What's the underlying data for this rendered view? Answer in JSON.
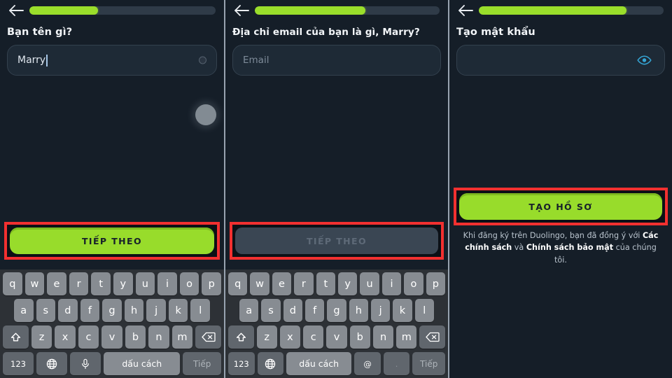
{
  "colors": {
    "accent_green": "#98dc2b",
    "highlight_red": "#f23030",
    "background": "#151e28",
    "field_bg": "#1e2a36",
    "eye_blue": "#35a6d6",
    "keyboard_bg": "#2d3136"
  },
  "panels": [
    {
      "id": "name-step",
      "back_label": "Back",
      "progress_percent": 37,
      "question": "Bạn tên gì?",
      "input": {
        "name": "name-input",
        "value": "Marry",
        "placeholder": "",
        "has_clear": true
      },
      "cta": {
        "label": "TIẾP THEO",
        "state": "enabled",
        "highlighted": true
      },
      "touch_indicator": true
    },
    {
      "id": "email-step",
      "back_label": "Back",
      "progress_percent": 60,
      "question": "Địa chỉ email của bạn là gì, Marry?",
      "input": {
        "name": "email-input",
        "value": "",
        "placeholder": "Email",
        "has_clear": false
      },
      "cta": {
        "label": "TIẾP THEO",
        "state": "disabled",
        "highlighted": true
      },
      "touch_indicator": false
    },
    {
      "id": "password-step",
      "back_label": "Back",
      "progress_percent": 80,
      "question": "Tạo mật khẩu",
      "input": {
        "name": "password-input",
        "value": "",
        "placeholder": "",
        "has_eye_toggle": true
      },
      "cta": {
        "label": "TẠO HỒ SƠ",
        "state": "enabled",
        "highlighted": true
      },
      "touch_indicator": false,
      "terms": {
        "part1": "Khi đăng ký trên Duolingo, bạn đã đồng ý với ",
        "link1": "Các chính sách",
        "part2": " và ",
        "link2": "Chính sách bảo mật",
        "part3": " của chúng tôi."
      }
    }
  ],
  "keyboard": {
    "row1": [
      "q",
      "w",
      "e",
      "r",
      "t",
      "y",
      "u",
      "i",
      "o",
      "p"
    ],
    "row2": [
      "a",
      "s",
      "d",
      "f",
      "g",
      "h",
      "j",
      "k",
      "l"
    ],
    "row3_shift": "shift-icon",
    "row3": [
      "z",
      "x",
      "c",
      "v",
      "b",
      "n",
      "m"
    ],
    "row3_backspace": "backspace-icon",
    "row4_numbers": "123",
    "row4_globe": "globe-icon",
    "row4_mic": "mic-icon",
    "row4_space": "dấu cách",
    "row4_at": "@",
    "row4_period": ".",
    "row4_action": "Tiếp"
  }
}
